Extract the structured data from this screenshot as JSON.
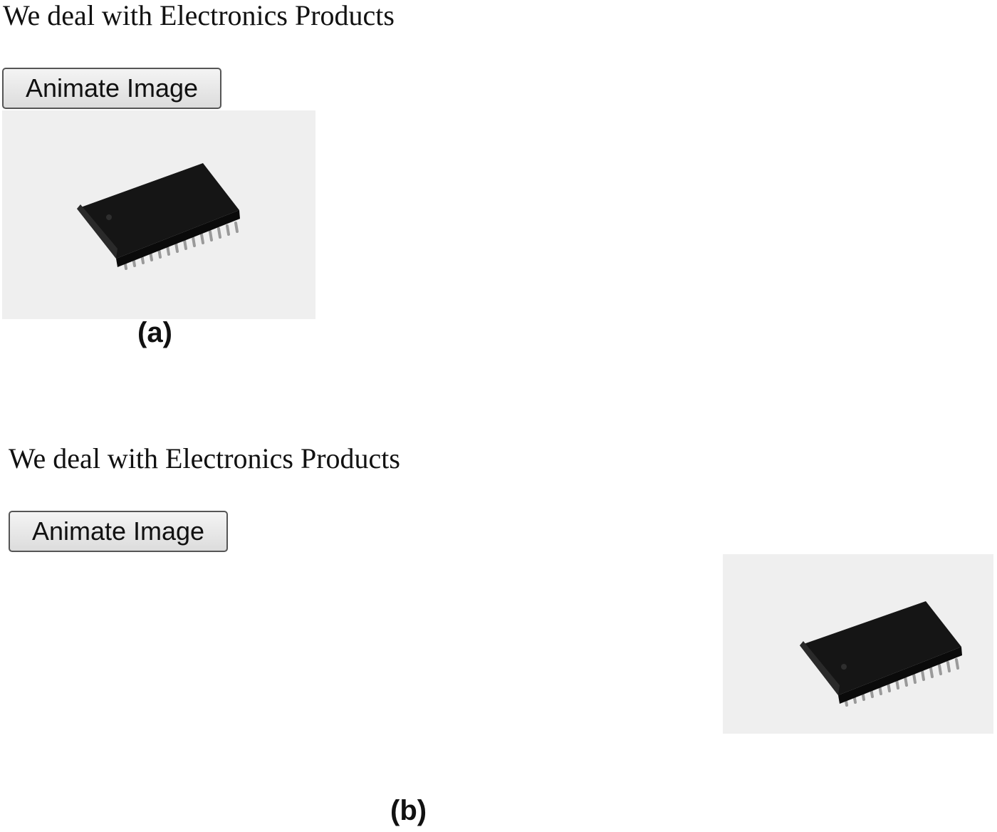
{
  "panels": [
    {
      "heading": "We deal with Electronics Products",
      "button_label": "Animate Image",
      "image": {
        "icon": "ic-chip-icon",
        "background": "#efefef"
      },
      "caption": "(a)"
    },
    {
      "heading": "We deal with Electronics Products",
      "button_label": "Animate Image",
      "image": {
        "icon": "ic-chip-icon",
        "background": "#efefef"
      },
      "caption": "(b)"
    }
  ]
}
